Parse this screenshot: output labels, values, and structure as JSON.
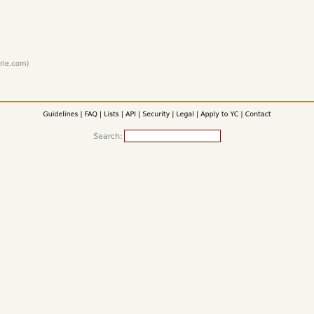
{
  "top_text": "rie.com)",
  "footer": {
    "links": [
      "Guidelines",
      "FAQ",
      "Lists",
      "API",
      "Security",
      "Legal",
      "Apply to YC",
      "Contact"
    ],
    "separator": "|"
  },
  "search": {
    "label": "Search:",
    "value": ""
  },
  "colors": {
    "background": "#f6f6ef",
    "divider": "#ff6600",
    "input_border": "#8b0000",
    "muted_text": "#828282"
  }
}
